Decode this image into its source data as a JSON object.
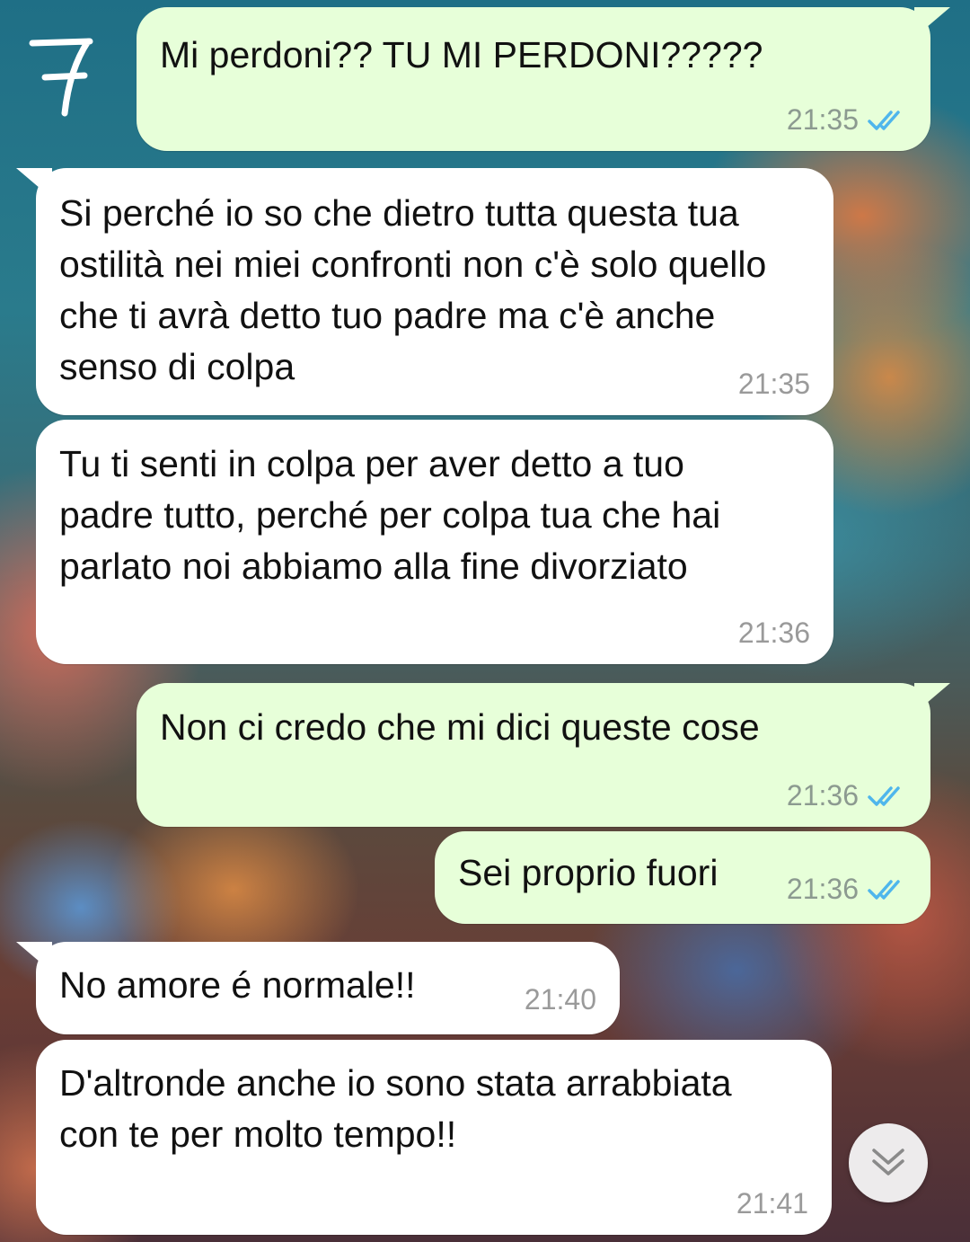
{
  "annotation_label": "7",
  "messages": [
    {
      "type": "outgoing",
      "text": "Mi perdoni?? TU MI PERDONI?????",
      "time": "21:35",
      "read": true
    },
    {
      "type": "incoming",
      "text": "Si perché io so che dietro tutta questa tua ostilità nei miei confronti non c'è solo quello che ti avrà detto tuo padre ma c'è anche senso di colpa",
      "time": "21:35"
    },
    {
      "type": "incoming",
      "text": "Tu ti senti in colpa per aver detto a tuo padre tutto, perché per colpa tua che hai parlato noi abbiamo alla fine divorziato",
      "time": "21:36"
    },
    {
      "type": "outgoing",
      "text": "Non ci credo che mi dici queste cose",
      "time": "21:36",
      "read": true
    },
    {
      "type": "outgoing",
      "text": "Sei proprio fuori",
      "time": "21:36",
      "read": true
    },
    {
      "type": "incoming",
      "text": "No amore é normale!!",
      "time": "21:40"
    },
    {
      "type": "incoming",
      "text": "D'altronde anche io sono stata arrabbiata con te per molto tempo!!",
      "time": "21:41"
    }
  ],
  "colors": {
    "outgoing_bubble": "#e7ffd9",
    "incoming_bubble": "#ffffff",
    "read_ticks": "#4fb6ec"
  },
  "icons": {
    "read_receipt": "double-check-icon",
    "scroll_down": "double-chevron-down-icon"
  }
}
